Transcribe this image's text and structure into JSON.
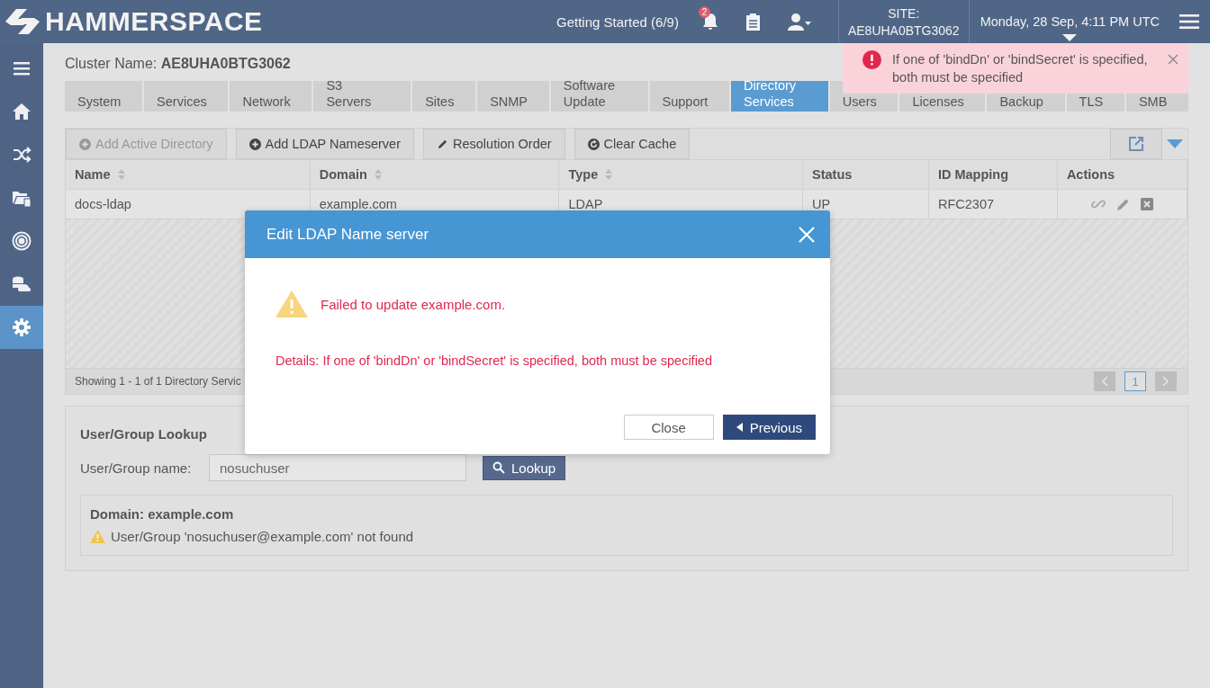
{
  "header": {
    "logo": "HAMMERSPACE",
    "getting_started": "Getting Started (6/9)",
    "notification_count": "2",
    "site_label": "SITE:",
    "site_name": "AE8UHA0BTG3062",
    "datetime": "Monday, 28 Sep, 4:11 PM UTC"
  },
  "sidebar": {
    "items": [
      {
        "selected": false
      },
      {
        "selected": false
      },
      {
        "selected": false
      },
      {
        "selected": false
      },
      {
        "selected": false
      },
      {
        "selected": false
      },
      {
        "selected": true
      }
    ]
  },
  "cluster": {
    "label": "Cluster Name:",
    "name": "AE8UHA0BTG3062"
  },
  "tabs": [
    {
      "label": "System",
      "selected": false
    },
    {
      "label": "Services",
      "selected": false
    },
    {
      "label": "Network",
      "selected": false
    },
    {
      "label": "S3 Servers",
      "selected": false
    },
    {
      "label": "Sites",
      "selected": false
    },
    {
      "label": "SNMP",
      "selected": false
    },
    {
      "label": "Software Update",
      "selected": false
    },
    {
      "label": "Support",
      "selected": false
    },
    {
      "label": "Directory Services",
      "selected": true
    },
    {
      "label": "Users",
      "selected": false
    },
    {
      "label": "Licenses",
      "selected": false
    },
    {
      "label": "Backup",
      "selected": false
    },
    {
      "label": "TLS",
      "selected": false
    },
    {
      "label": "SMB",
      "selected": false
    }
  ],
  "toolbar": [
    {
      "label": "Add Active Directory",
      "kind": "plus",
      "disabled": true
    },
    {
      "label": "Add LDAP Nameserver",
      "kind": "plus",
      "disabled": false
    },
    {
      "label": "Resolution Order",
      "kind": "pencil",
      "disabled": false
    },
    {
      "label": "Clear Cache",
      "kind": "refresh",
      "disabled": false
    }
  ],
  "table": {
    "columns": [
      {
        "label": "Name",
        "sortable": true
      },
      {
        "label": "Domain",
        "sortable": true
      },
      {
        "label": "Type",
        "sortable": true
      },
      {
        "label": "Status",
        "sortable": false
      },
      {
        "label": "ID Mapping",
        "sortable": false
      },
      {
        "label": "Actions",
        "sortable": false
      }
    ],
    "rows": [
      [
        "docs-ldap",
        "example.com",
        "LDAP",
        "UP",
        "RFC2307"
      ]
    ],
    "footer": "Showing 1 - 1 of 1 Directory Servic",
    "pages": [
      {
        "label": "1",
        "selected": true
      }
    ]
  },
  "lookup": {
    "title": "User/Group Lookup",
    "label": "User/Group name:",
    "value": "nosuchuser",
    "button": "Lookup",
    "result_domain": "Domain: example.com",
    "result_message": "User/Group 'nosuchuser@example.com' not found"
  },
  "toast": {
    "message": "If one of 'bindDn' or 'bindSecret' is specified, both must be specified"
  },
  "modal": {
    "title": "Edit LDAP Name server",
    "error": "Failed to update example.com.",
    "details": "Details: If one of 'bindDn' or 'bindSecret' is specified, both must be specified",
    "buttons": [
      {
        "label": "Close",
        "kind": "secondary"
      },
      {
        "label": "Previous",
        "kind": "primary"
      }
    ]
  }
}
